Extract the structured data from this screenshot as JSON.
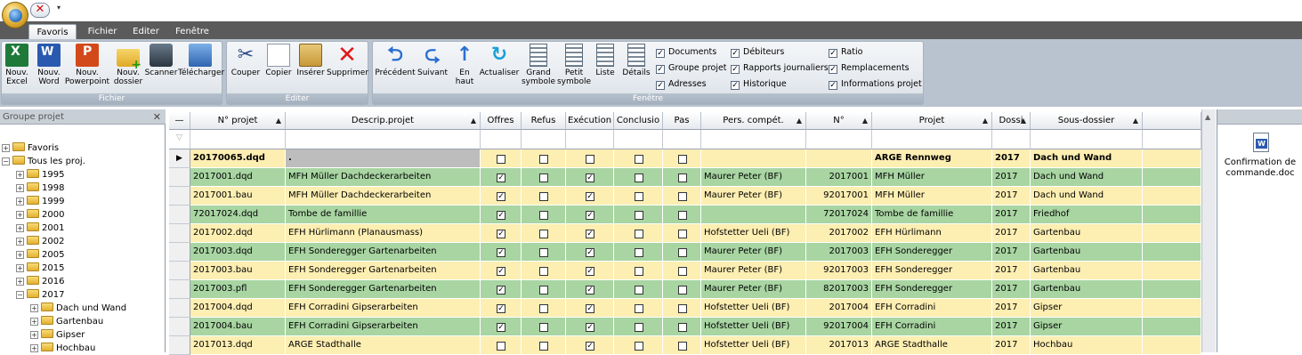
{
  "quick_access": {
    "close_glyph": "✕",
    "dropdown_glyph": "▾"
  },
  "tabs": [
    {
      "label": "Favoris",
      "active": true
    },
    {
      "label": "Fichier",
      "active": false
    },
    {
      "label": "Editer",
      "active": false
    },
    {
      "label": "Fenêtre",
      "active": false
    }
  ],
  "ribbon": {
    "fichier": {
      "label": "Fichier",
      "buttons": [
        {
          "label1": "Nouv.",
          "label2": "Excel",
          "icon": "excel-icon"
        },
        {
          "label1": "Nouv.",
          "label2": "Word",
          "icon": "word-icon"
        },
        {
          "label1": "Nouv.",
          "label2": "Powerpoint",
          "icon": "powerpoint-icon"
        },
        {
          "label1": "Nouv.",
          "label2": "dossier",
          "icon": "new-folder-icon"
        },
        {
          "label1": "Scanner",
          "label2": "",
          "icon": "scanner-icon"
        },
        {
          "label1": "Télécharger",
          "label2": "",
          "icon": "download-icon"
        }
      ]
    },
    "editer": {
      "label": "Editer",
      "buttons": [
        {
          "label1": "Couper",
          "icon": "scissors-icon"
        },
        {
          "label1": "Copier",
          "icon": "copy-icon"
        },
        {
          "label1": "Insérer",
          "icon": "paste-icon"
        },
        {
          "label1": "Supprimer",
          "icon": "delete-icon"
        }
      ]
    },
    "fenetre": {
      "label": "Fenêtre",
      "buttons": [
        {
          "label1": "Précédent",
          "label2": "",
          "icon": "back-arrow-icon"
        },
        {
          "label1": "Suivant",
          "label2": "",
          "icon": "forward-arrow-icon"
        },
        {
          "label1": "En",
          "label2": "haut",
          "icon": "up-arrow-icon"
        },
        {
          "label1": "Actualiser",
          "label2": "",
          "icon": "refresh-icon"
        },
        {
          "label1": "Grand",
          "label2": "symbole",
          "icon": "large-icons-view-icon"
        },
        {
          "label1": "Petit",
          "label2": "symbole",
          "icon": "small-icons-view-icon"
        },
        {
          "label1": "Liste",
          "label2": "",
          "icon": "list-view-icon"
        },
        {
          "label1": "Détails",
          "label2": "",
          "icon": "details-view-icon"
        }
      ],
      "checkboxes": [
        {
          "label": "Documents",
          "checked": true
        },
        {
          "label": "Groupe projet",
          "checked": true
        },
        {
          "label": "Adresses",
          "checked": true
        },
        {
          "label": "Débiteurs",
          "checked": true
        },
        {
          "label": "Rapports journaliers",
          "checked": true
        },
        {
          "label": "Historique",
          "checked": true
        },
        {
          "label": "Ratio",
          "checked": true
        },
        {
          "label": "Remplacements",
          "checked": true
        },
        {
          "label": "Informations projet",
          "checked": true
        }
      ]
    }
  },
  "left_panel": {
    "title": "Groupe projet",
    "close_glyph": "✕",
    "tree": [
      {
        "label": "Favoris",
        "expander": "+",
        "level": 0
      },
      {
        "label": "Tous les proj.",
        "expander": "−",
        "level": 0
      },
      {
        "label": "1995",
        "expander": "+",
        "level": 1
      },
      {
        "label": "1998",
        "expander": "+",
        "level": 1
      },
      {
        "label": "1999",
        "expander": "+",
        "level": 1
      },
      {
        "label": "2000",
        "expander": "+",
        "level": 1
      },
      {
        "label": "2001",
        "expander": "+",
        "level": 1
      },
      {
        "label": "2002",
        "expander": "+",
        "level": 1
      },
      {
        "label": "2005",
        "expander": "+",
        "level": 1
      },
      {
        "label": "2015",
        "expander": "+",
        "level": 1
      },
      {
        "label": "2016",
        "expander": "+",
        "level": 1
      },
      {
        "label": "2017",
        "expander": "−",
        "level": 1
      },
      {
        "label": "Dach und Wand",
        "expander": "+",
        "level": 2
      },
      {
        "label": "Gartenbau",
        "expander": "+",
        "level": 2
      },
      {
        "label": "Gipser",
        "expander": "+",
        "level": 2
      },
      {
        "label": "Hochbau",
        "expander": "+",
        "level": 2
      }
    ]
  },
  "grid": {
    "columns": [
      {
        "label": "—",
        "sort": ""
      },
      {
        "label": "N° projet",
        "sort": "▲"
      },
      {
        "label": "Descrip.projet",
        "sort": "▲"
      },
      {
        "label": "Offres",
        "sort": ""
      },
      {
        "label": "Refus",
        "sort": ""
      },
      {
        "label": "Exécution",
        "sort": ""
      },
      {
        "label": "Conclusio",
        "sort": ""
      },
      {
        "label": "Pas",
        "sort": ""
      },
      {
        "label": "Pers. compét.",
        "sort": "▲"
      },
      {
        "label": "N°",
        "sort": "▲"
      },
      {
        "label": "Projet",
        "sort": "▲"
      },
      {
        "label": "Dossi",
        "sort": "▲"
      },
      {
        "label": "Sous-dossier",
        "sort": "▲"
      },
      {
        "label": "",
        "sort": ""
      }
    ],
    "filter_icon": "▽",
    "current_row_glyph": "▶",
    "rows": [
      {
        "nr": "20170065.dqd",
        "desc": ".",
        "offres": false,
        "refus": false,
        "exec": false,
        "concl": false,
        "pas": false,
        "pers": "",
        "num": "",
        "projet": "ARGE Rennweg",
        "dossier": "2017",
        "sous": "Dach und Wand",
        "style": "yellow",
        "current": true,
        "bold": true
      },
      {
        "nr": "2017001.dqd",
        "desc": "MFH Müller Dachdeckerarbeiten",
        "offres": true,
        "refus": false,
        "exec": true,
        "concl": false,
        "pas": false,
        "pers": "Maurer Peter (BF)",
        "num": "2017001",
        "projet": "MFH Müller",
        "dossier": "2017",
        "sous": "Dach und Wand",
        "style": "green"
      },
      {
        "nr": "2017001.bau",
        "desc": "MFH Müller Dachdeckerarbeiten",
        "offres": true,
        "refus": false,
        "exec": true,
        "concl": false,
        "pas": false,
        "pers": "Maurer Peter (BF)",
        "num": "92017001",
        "projet": "MFH Müller",
        "dossier": "2017",
        "sous": "Dach und Wand",
        "style": "yellow"
      },
      {
        "nr": "72017024.dqd",
        "desc": "Tombe de famillie",
        "offres": true,
        "refus": false,
        "exec": true,
        "concl": false,
        "pas": false,
        "pers": "",
        "num": "72017024",
        "projet": "Tombe de famillie",
        "dossier": "2017",
        "sous": "Friedhof",
        "style": "green"
      },
      {
        "nr": "2017002.dqd",
        "desc": "EFH Hürlimann (Planausmass)",
        "offres": true,
        "refus": false,
        "exec": true,
        "concl": false,
        "pas": false,
        "pers": "Hofstetter Ueli (BF)",
        "num": "2017002",
        "projet": "EFH Hürlimann",
        "dossier": "2017",
        "sous": "Gartenbau",
        "style": "yellow"
      },
      {
        "nr": "2017003.dqd",
        "desc": "EFH Sonderegger Gartenarbeiten",
        "offres": true,
        "refus": false,
        "exec": true,
        "concl": false,
        "pas": false,
        "pers": "Maurer Peter (BF)",
        "num": "2017003",
        "projet": "EFH Sonderegger",
        "dossier": "2017",
        "sous": "Gartenbau",
        "style": "green"
      },
      {
        "nr": "2017003.bau",
        "desc": "EFH Sonderegger Gartenarbeiten",
        "offres": true,
        "refus": false,
        "exec": true,
        "concl": false,
        "pas": false,
        "pers": "Maurer Peter (BF)",
        "num": "92017003",
        "projet": "EFH Sonderegger",
        "dossier": "2017",
        "sous": "Gartenbau",
        "style": "yellow"
      },
      {
        "nr": "2017003.pfl",
        "desc": "EFH Sonderegger Gartenarbeiten",
        "offres": true,
        "refus": false,
        "exec": true,
        "concl": false,
        "pas": false,
        "pers": "Maurer Peter (BF)",
        "num": "82017003",
        "projet": "EFH Sonderegger",
        "dossier": "2017",
        "sous": "Gartenbau",
        "style": "green"
      },
      {
        "nr": "2017004.dqd",
        "desc": "EFH Corradini Gipserarbeiten",
        "offres": true,
        "refus": false,
        "exec": true,
        "concl": false,
        "pas": false,
        "pers": "Hofstetter Ueli (BF)",
        "num": "2017004",
        "projet": "EFH Corradini",
        "dossier": "2017",
        "sous": "Gipser",
        "style": "yellow"
      },
      {
        "nr": "2017004.bau",
        "desc": "EFH Corradini Gipserarbeiten",
        "offres": true,
        "refus": false,
        "exec": true,
        "concl": false,
        "pas": false,
        "pers": "Hofstetter Ueli (BF)",
        "num": "92017004",
        "projet": "EFH Corradini",
        "dossier": "2017",
        "sous": "Gipser",
        "style": "green"
      },
      {
        "nr": "2017013.dqd",
        "desc": "ARGE Stadthalle",
        "offres": false,
        "refus": false,
        "exec": true,
        "concl": false,
        "pas": false,
        "pers": "Hofstetter Ueli (BF)",
        "num": "2017013",
        "projet": "ARGE Stadthalle",
        "dossier": "2017",
        "sous": "Hochbau",
        "style": "yellow"
      }
    ]
  },
  "right_panel": {
    "file_label": "Confirmation de commande.doc",
    "file_icon": "word-document-icon"
  },
  "colors": {
    "row_yellow": "#fdeeb2",
    "row_green": "#a8d5a2",
    "row_current_nr": "#bdbdbd",
    "tab_bar": "#5b5b5b",
    "ribbon_bg": "#b9c3cf"
  },
  "scrollbar": {
    "up_glyph": "▲"
  }
}
